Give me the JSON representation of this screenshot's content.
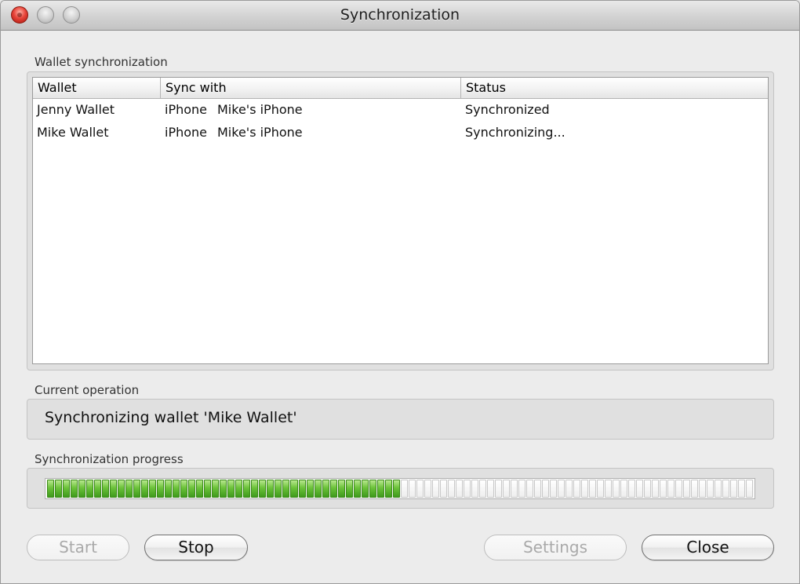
{
  "window": {
    "title": "Synchronization"
  },
  "wallet_sync": {
    "label": "Wallet synchronization",
    "columns": [
      "Wallet",
      "Sync with",
      "Status"
    ],
    "rows": [
      {
        "wallet": "Jenny Wallet",
        "device_type": "iPhone",
        "device_name": "Mike's iPhone",
        "status": "Synchronized"
      },
      {
        "wallet": "Mike Wallet",
        "device_type": "iPhone",
        "device_name": "Mike's iPhone",
        "status": "Synchronizing..."
      }
    ]
  },
  "current_operation": {
    "label": "Current operation",
    "text": "Synchronizing wallet 'Mike Wallet'"
  },
  "progress": {
    "label": "Synchronization progress",
    "fraction": 0.5,
    "accent_color": "#6cc23a"
  },
  "buttons": {
    "start": {
      "label": "Start",
      "enabled": false
    },
    "stop": {
      "label": "Stop",
      "enabled": true
    },
    "settings": {
      "label": "Settings",
      "enabled": false
    },
    "close": {
      "label": "Close",
      "enabled": true
    }
  }
}
